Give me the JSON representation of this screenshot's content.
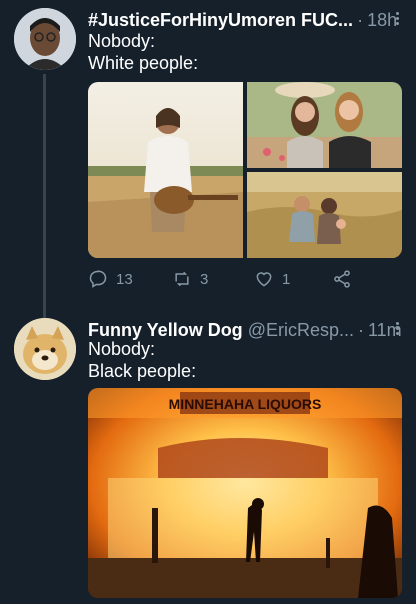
{
  "tweets": [
    {
      "name": "#JusticeForHinyUmoren FUC...",
      "handle": "",
      "time": "18h",
      "lines": [
        "Nobody:",
        "White people:"
      ],
      "media_count": 3,
      "actions": {
        "reply": "13",
        "retweet": "3",
        "like": "1"
      }
    },
    {
      "name": "Funny Yellow Dog",
      "handle": "@EricResp...",
      "time": "11m",
      "lines": [
        "Nobody:",
        "Black people:"
      ],
      "media_count": 1,
      "sign_text": "MINNEHAHA LIQUORS"
    }
  ],
  "icons": [
    "reply-icon",
    "retweet-icon",
    "like-icon",
    "share-icon",
    "more-icon"
  ],
  "colors": {
    "background": "#15202b",
    "muted": "#8899a6",
    "divider": "#38444d"
  }
}
